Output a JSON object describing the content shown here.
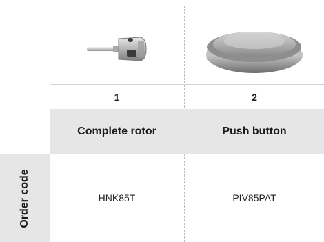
{
  "products": [
    {
      "number": "1",
      "name": "Complete rotor",
      "order_code": "HNK85T",
      "image": "rotor-image"
    },
    {
      "number": "2",
      "name": "Push button",
      "order_code": "PIV85PAT",
      "image": "push-button-image"
    }
  ],
  "row_label": "Order code"
}
